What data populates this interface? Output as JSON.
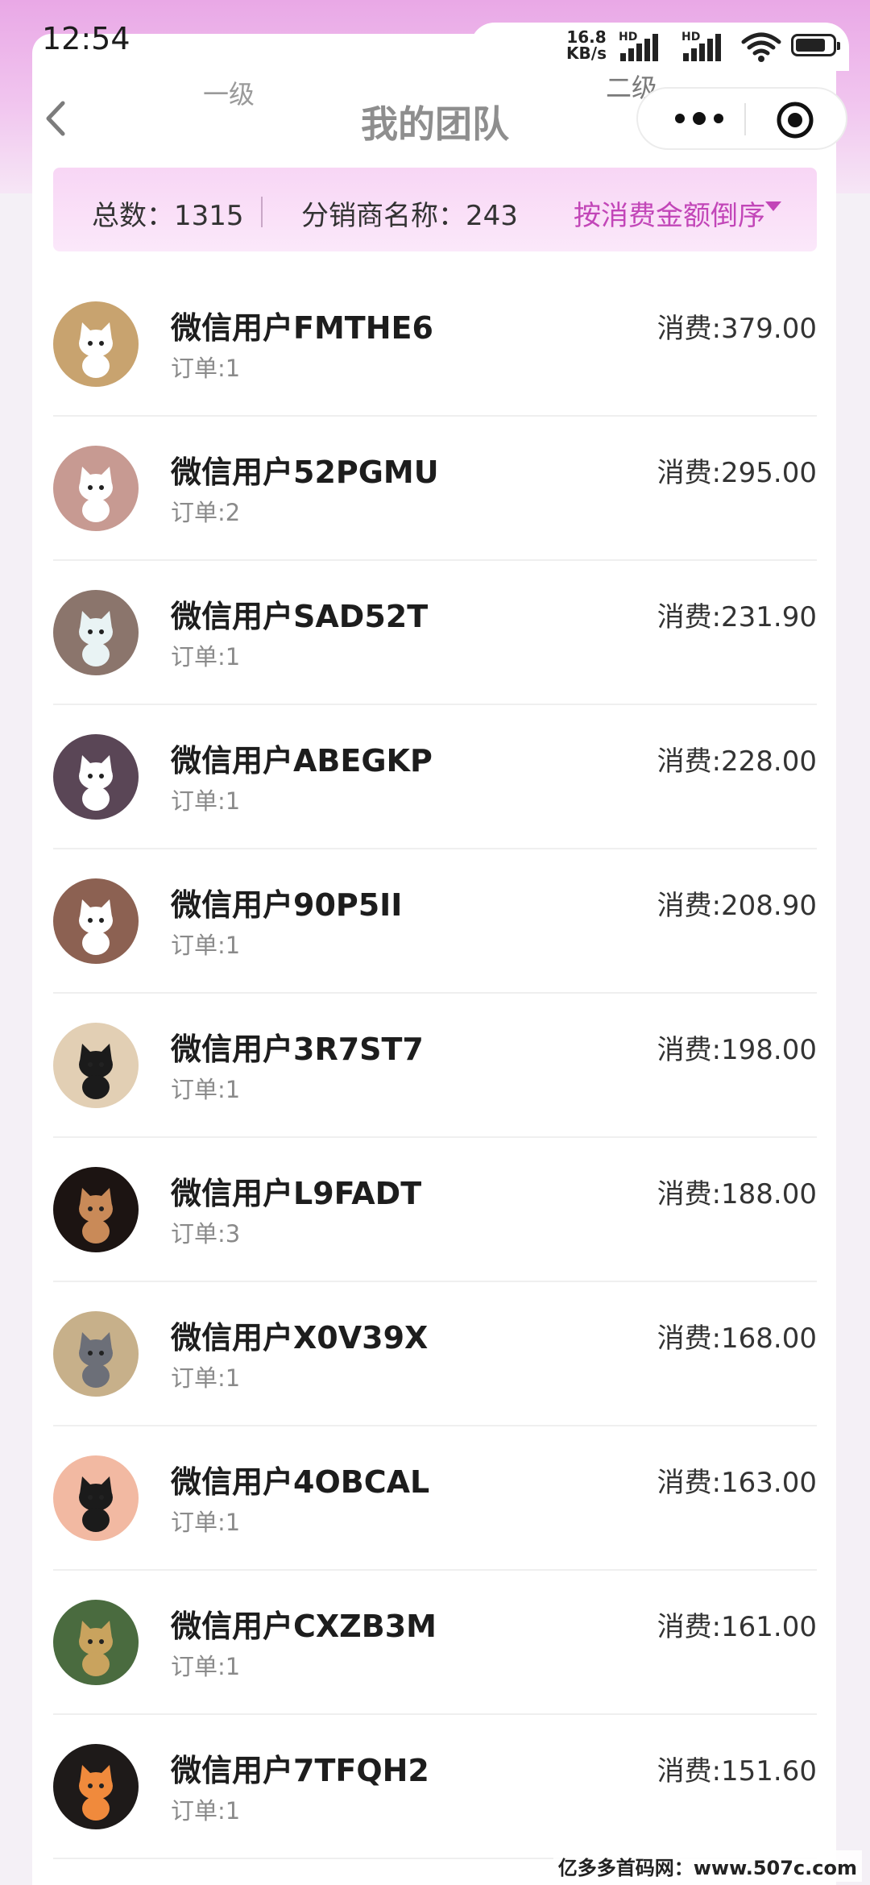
{
  "status_bar": {
    "time": "12:54",
    "net_speed_value": "16.8",
    "net_speed_unit": "KB/s",
    "signal1_tag": "HD",
    "signal2_tag": "HD"
  },
  "header": {
    "tab_level1": "一级",
    "tab_level2": "二级",
    "title": "我的团队"
  },
  "summary": {
    "total": "总数：1315",
    "distributors": "分销商名称：243",
    "sort_label": "按消费金额倒序"
  },
  "members": [
    {
      "name": "微信用户FMTHE6",
      "orders": "订单:1",
      "amount": "消费:379.00",
      "avatar_bg": "#c8a36f",
      "avatar_fg": "#ffffff"
    },
    {
      "name": "微信用户52PGMU",
      "orders": "订单:2",
      "amount": "消费:295.00",
      "avatar_bg": "#c79a92",
      "avatar_fg": "#ffffff"
    },
    {
      "name": "微信用户SAD52T",
      "orders": "订单:1",
      "amount": "消费:231.90",
      "avatar_bg": "#8b756c",
      "avatar_fg": "#e9f3f4"
    },
    {
      "name": "微信用户ABEGKP",
      "orders": "订单:1",
      "amount": "消费:228.00",
      "avatar_bg": "#5a4656",
      "avatar_fg": "#ffffff"
    },
    {
      "name": "微信用户90P5II",
      "orders": "订单:1",
      "amount": "消费:208.90",
      "avatar_bg": "#8c6152",
      "avatar_fg": "#ffffff"
    },
    {
      "name": "微信用户3R7ST7",
      "orders": "订单:1",
      "amount": "消费:198.00",
      "avatar_bg": "#e2cfb4",
      "avatar_fg": "#1b1b1b"
    },
    {
      "name": "微信用户L9FADT",
      "orders": "订单:3",
      "amount": "消费:188.00",
      "avatar_bg": "#1c1412",
      "avatar_fg": "#c98a58"
    },
    {
      "name": "微信用户X0V39X",
      "orders": "订单:1",
      "amount": "消费:168.00",
      "avatar_bg": "#c7b08a",
      "avatar_fg": "#6c6f78"
    },
    {
      "name": "微信用户4OBCAL",
      "orders": "订单:1",
      "amount": "消费:163.00",
      "avatar_bg": "#f2b9a2",
      "avatar_fg": "#1b1b1b"
    },
    {
      "name": "微信用户CXZB3M",
      "orders": "订单:1",
      "amount": "消费:161.00",
      "avatar_bg": "#4a6b3f",
      "avatar_fg": "#c9a35e"
    },
    {
      "name": "微信用户7TFQH2",
      "orders": "订单:1",
      "amount": "消费:151.60",
      "avatar_bg": "#1e1a19",
      "avatar_fg": "#f08a3c"
    }
  ],
  "watermark": "亿多多首码网：www.507c.com"
}
